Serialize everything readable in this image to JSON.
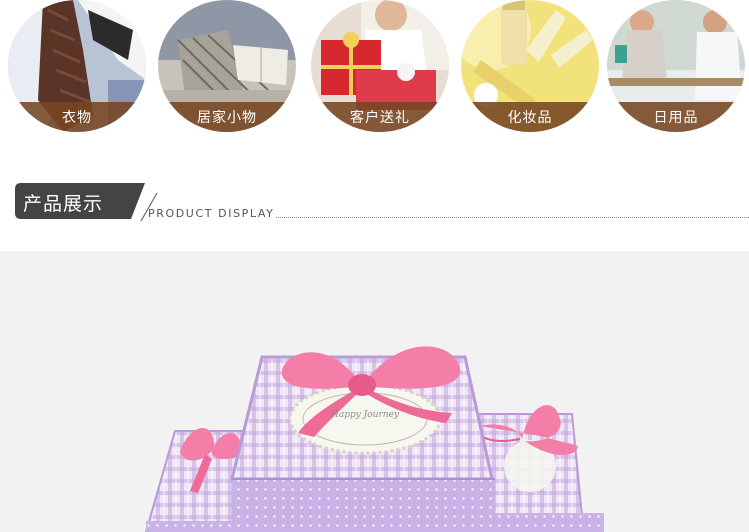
{
  "categories": [
    {
      "label": "衣物",
      "icon": "shirt-tie-photo"
    },
    {
      "label": "居家小物",
      "icon": "home-goods-photo"
    },
    {
      "label": "客户送礼",
      "icon": "gift-photo"
    },
    {
      "label": "化妆品",
      "icon": "cosmetics-photo"
    },
    {
      "label": "日用品",
      "icon": "daily-goods-photo"
    }
  ],
  "section": {
    "title": "产品展示",
    "subtitle": "PRODUCT DISPLAY"
  },
  "product": {
    "lid_text": "Happy Journey",
    "colors": {
      "box": "#c9b3e6",
      "ribbon": "#f47ea8"
    }
  }
}
